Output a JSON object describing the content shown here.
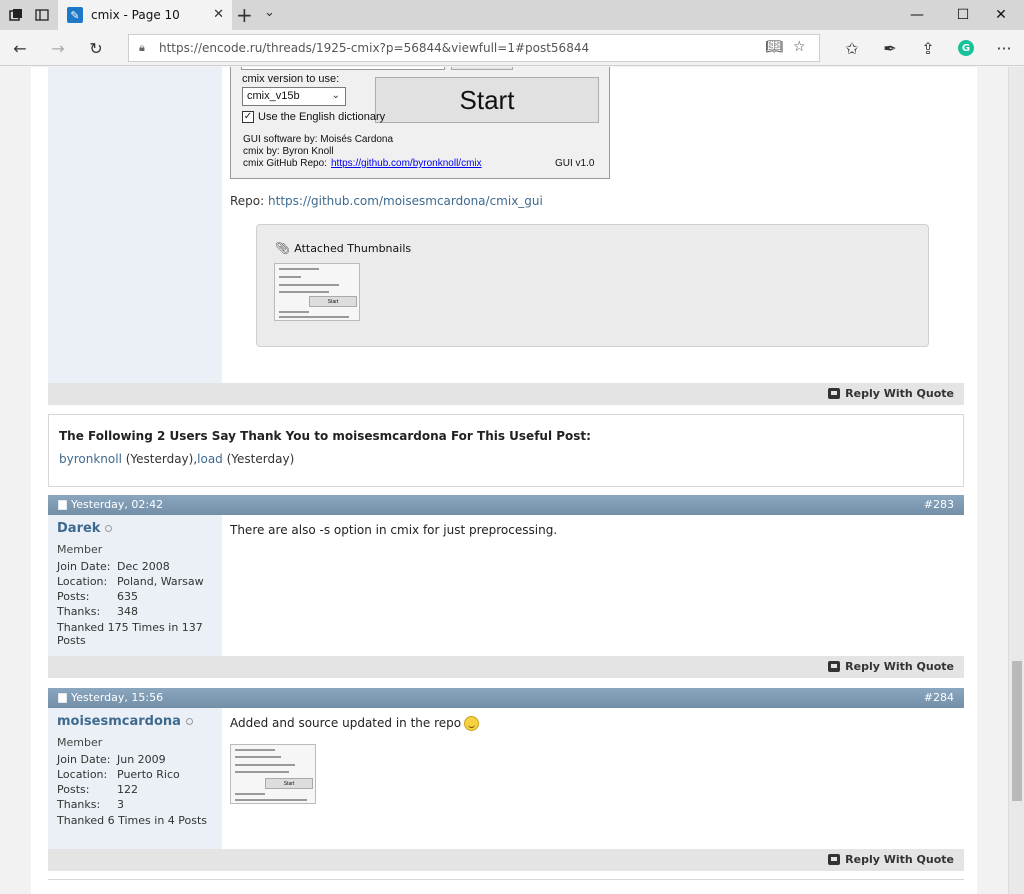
{
  "browser": {
    "tab_title": "cmix - Page 10",
    "url": "https://encode.ru/threads/1925-cmix?p=56844&viewfull=1#post56844",
    "grammarly_letter": "G",
    "more_label": "···"
  },
  "post_prev": {
    "gui": {
      "version_label": "cmix version to use:",
      "version_value": "cmix_v15b",
      "start_label": "Start",
      "dict_label": "Use the English dictionary",
      "credit_gui": "GUI software by: Moisés Cardona",
      "credit_cmix": "cmix by: Byron Knoll",
      "repo_label": "cmix GitHub Repo:",
      "repo_link": "https://github.com/byronknoll/cmix",
      "gui_version": "GUI v1.0"
    },
    "repo_prefix": "Repo:",
    "repo_link": "https://github.com/moisesmcardona/cmix_gui",
    "attachments_title": "Attached Thumbnails",
    "reply_label": "Reply With Quote"
  },
  "thanks": {
    "title": "The Following 2 Users Say Thank You to moisesmcardona For This Useful Post:",
    "user1": "byronknoll",
    "user1_when": " (Yesterday),",
    "user2": "load",
    "user2_when": " (Yesterday)"
  },
  "posts": [
    {
      "date": "Yesterday, 02:42",
      "number": "#283",
      "username": "Darek",
      "user_title": "Member",
      "join_label": "Join Date:",
      "join": "Dec 2008",
      "location_label": "Location:",
      "location": "Poland, Warsaw",
      "posts_label": "Posts:",
      "posts": "635",
      "thanks_label": "Thanks:",
      "thanks": "348",
      "thanked": "Thanked 175 Times in 137 Posts",
      "text": "There are also -s option in cmix for just preprocessing.",
      "reply_label": "Reply With Quote"
    },
    {
      "date": "Yesterday, 15:56",
      "number": "#284",
      "username": "moisesmcardona",
      "user_title": "Member",
      "join_label": "Join Date:",
      "join": "Jun 2009",
      "location_label": "Location:",
      "location": "Puerto Rico",
      "posts_label": "Posts:",
      "posts": "122",
      "thanks_label": "Thanks:",
      "thanks": "3",
      "thanked": "Thanked 6 Times in 4 Posts",
      "text": "Added and source updated in the repo",
      "reply_label": "Reply With Quote"
    }
  ]
}
